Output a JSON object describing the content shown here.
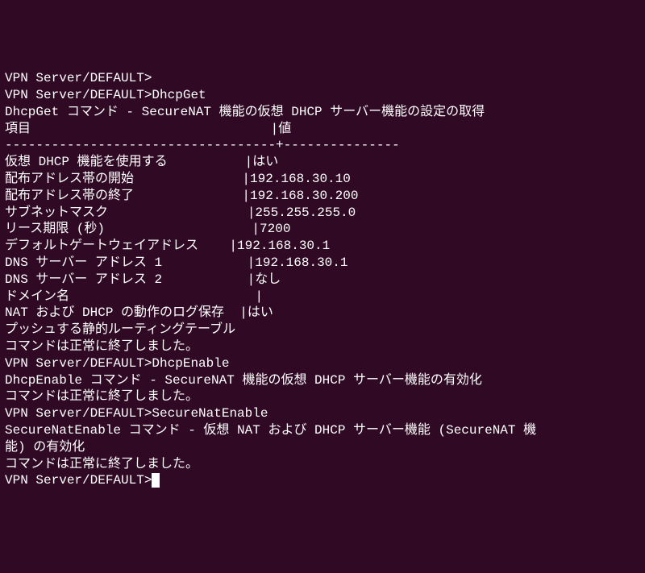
{
  "prompt": "VPN Server/DEFAULT>",
  "cmd_dhcpget": "DhcpGet",
  "dhcpget_desc": "DhcpGet コマンド - SecureNAT 機能の仮想 DHCP サーバー機能の設定の取得",
  "header_item": "項目",
  "header_value": "値",
  "sep_left": "-----------------------------------",
  "sep_right": "---------------",
  "pipe": "|",
  "table": [
    {
      "label": "仮想 DHCP 機能を使用する          ",
      "value": "はい"
    },
    {
      "label": "配布アドレス帯の開始              ",
      "value": "192.168.30.10"
    },
    {
      "label": "配布アドレス帯の終了              ",
      "value": "192.168.30.200"
    },
    {
      "label": "サブネットマスク                  ",
      "value": "255.255.255.0"
    },
    {
      "label": "リース期限 (秒)                   ",
      "value": "7200"
    },
    {
      "label": "デフォルトゲートウェイアドレス    ",
      "value": "192.168.30.1"
    },
    {
      "label": "DNS サーバー アドレス 1           ",
      "value": "192.168.30.1"
    },
    {
      "label": "DNS サーバー アドレス 2           ",
      "value": "なし"
    },
    {
      "label": "ドメイン名                        ",
      "value": ""
    },
    {
      "label": "NAT および DHCP の動作のログ保存  ",
      "value": "はい"
    },
    {
      "label": "プッシュする静的ルーティングテーブル",
      "value": ""
    }
  ],
  "header_item_pad": "項目                               ",
  "completed": "コマンドは正常に終了しました。",
  "blank": "",
  "cmd_dhcpenable": "DhcpEnable",
  "dhcpenable_desc": "DhcpEnable コマンド - SecureNAT 機能の仮想 DHCP サーバー機能の有効化",
  "cmd_securenatenable": "SecureNatEnable",
  "securenatenable_desc1": "SecureNatEnable コマンド - 仮想 NAT および DHCP サーバー機能 (SecureNAT 機",
  "securenatenable_desc2": "能) の有効化"
}
